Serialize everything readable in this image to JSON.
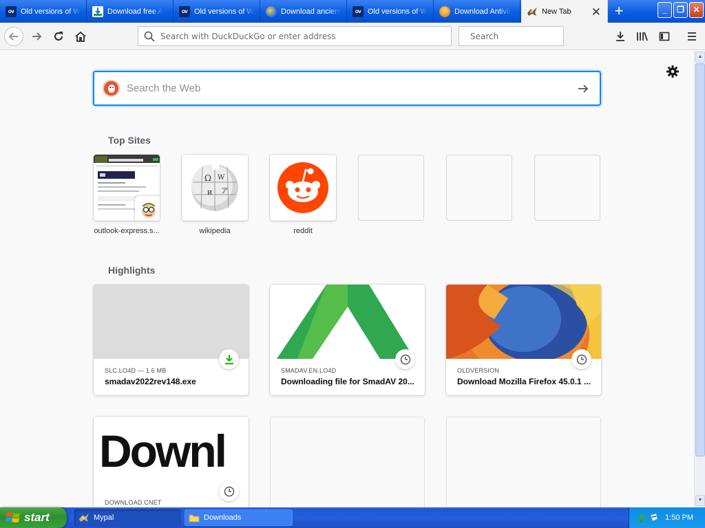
{
  "tabs": [
    {
      "label": "Old versions of W",
      "icon": "oldversion-icon",
      "icon_text": "ov"
    },
    {
      "label": "Download free A",
      "icon": "download-site-icon"
    },
    {
      "label": "Old versions of W",
      "icon": "oldversion-icon",
      "icon_text": "ov"
    },
    {
      "label": "Download ancient",
      "icon": "globe-icon"
    },
    {
      "label": "Old versions of W",
      "icon": "oldversion-icon",
      "icon_text": "ov"
    },
    {
      "label": "Download Antivir",
      "icon": "shield-icon"
    },
    {
      "label": "New Tab",
      "icon": "mypal-icon",
      "active": true
    }
  ],
  "toolbar": {
    "url_placeholder": "Search with DuckDuckGo or enter address",
    "search_placeholder": "Search"
  },
  "newtab": {
    "websearch_placeholder": "Search the Web",
    "top_sites_title": "Top Sites",
    "highlights_title": "Highlights",
    "top_sites": [
      {
        "label": "outlook-express.s..."
      },
      {
        "label": "wikipedia"
      },
      {
        "label": "reddit"
      },
      {
        "label": ""
      },
      {
        "label": ""
      },
      {
        "label": ""
      }
    ],
    "highlights": [
      {
        "host": "SLC.LO4D — 1.6 MB",
        "title": "smadav2022rev148.exe",
        "badge": "download-icon"
      },
      {
        "host": "SMADAV.EN.LO4D",
        "title": "Downloading file for SmadAV 20...",
        "badge": "clock-icon"
      },
      {
        "host": "OLDVERSION",
        "title": "Download Mozilla Firefox 45.0.1 ...",
        "badge": "clock-icon"
      },
      {
        "host": "DOWNLOAD.CNET",
        "title": "",
        "badge": "clock-icon",
        "image_text": "Downl"
      }
    ]
  },
  "taskbar": {
    "start_label": "start",
    "tasks": [
      {
        "label": "Mypal",
        "active": false
      },
      {
        "label": "Downloads",
        "active": true
      }
    ],
    "clock": "1:50 PM"
  },
  "colors": {
    "accent": "#0a84ff",
    "reddit": "#ff4500",
    "smadav_green": "#2fa84f",
    "xp_blue": "#245edb",
    "xp_green": "#3aa13a"
  }
}
